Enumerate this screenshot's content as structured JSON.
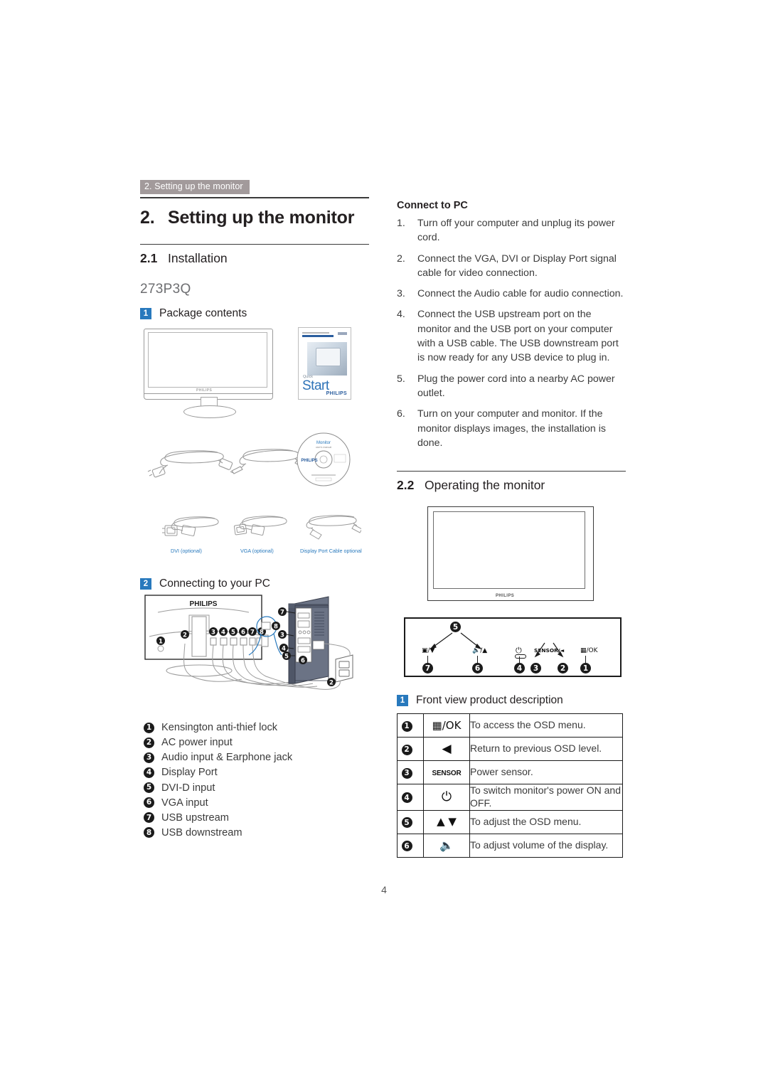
{
  "running_header": "2. Setting up the monitor",
  "chapter": {
    "number": "2.",
    "title": "Setting up the monitor"
  },
  "section_installation": {
    "number": "2.1",
    "title": "Installation"
  },
  "model": "273P3Q",
  "package_contents": {
    "badge": "1",
    "title": "Package contents",
    "monitor_brand": "PHILIPS",
    "guide": {
      "quick_label": "Quick",
      "start_label": "Start",
      "brand": "PHILIPS"
    },
    "cd": {
      "title": "Monitor",
      "subtitle": "user's manual",
      "brand": "PHILIPS"
    },
    "cable_labels": [
      "DVI (optional)",
      "VGA  (optional)",
      "Display Port Cable   optional"
    ]
  },
  "connecting": {
    "badge": "2",
    "title": "Connecting to your PC",
    "monitor_brand": "PHILIPS",
    "legend": [
      {
        "num": "1",
        "text": "Kensington anti-thief lock"
      },
      {
        "num": "2",
        "text": "AC power input"
      },
      {
        "num": "3",
        "text": "Audio input & Earphone jack"
      },
      {
        "num": "4",
        "text": "Display Port"
      },
      {
        "num": "5",
        "text": "DVI-D input"
      },
      {
        "num": "6",
        "text": "VGA input"
      },
      {
        "num": "7",
        "text": "USB upstream"
      },
      {
        "num": "8",
        "text": "USB downstream"
      }
    ]
  },
  "connect_to_pc": {
    "heading": "Connect to PC",
    "steps": [
      {
        "n": "1.",
        "t": "Turn off your computer and unplug its power cord."
      },
      {
        "n": "2.",
        "t": "Connect the VGA, DVI or Display Port signal cable for video connection."
      },
      {
        "n": "3.",
        "t": "Connect the Audio cable for audio connection."
      },
      {
        "n": "4.",
        "t": "Connect the USB upstream port on the monitor and the USB port on your computer with a USB cable. The USB downstream port is now ready for any USB device to plug in."
      },
      {
        "n": "5.",
        "t": "Plug the power cord into a nearby AC power outlet."
      },
      {
        "n": "6.",
        "t": "Turn on your computer and monitor. If the monitor displays images, the installation is done."
      }
    ]
  },
  "section_operating": {
    "number": "2.2",
    "title": "Operating the monitor"
  },
  "front_view": {
    "badge": "1",
    "title": "Front view product description",
    "panel_labels": [
      {
        "num": "7",
        "label": "✇/▼"
      },
      {
        "num": "6",
        "label": "◂)/▲"
      },
      {
        "num": "5",
        "label": ""
      },
      {
        "num": "4",
        "label": "power"
      },
      {
        "num": "3",
        "label": "SENSOR"
      },
      {
        "num": "2",
        "label": "/◄"
      },
      {
        "num": "1",
        "label": "▤/OK"
      }
    ],
    "panel_text_left": "/▼",
    "panel_text_vol": "/▲",
    "panel_text_sensor": "SENSOR/◄",
    "panel_text_ok": "/OK",
    "table": [
      {
        "num": "1",
        "icon": "menu-ok",
        "icon_text": "/OK",
        "desc": "To access the OSD menu."
      },
      {
        "num": "2",
        "icon": "left-triangle",
        "icon_text": "◀",
        "desc": "Return to previous OSD level."
      },
      {
        "num": "3",
        "icon": "sensor",
        "icon_text": "SENSOR",
        "desc": "Power sensor."
      },
      {
        "num": "4",
        "icon": "power",
        "icon_text": "⏻",
        "desc": "To switch monitor's power ON and OFF."
      },
      {
        "num": "5",
        "icon": "up-down-triangles",
        "icon_text": "▲ ▼",
        "desc": "To adjust the OSD menu."
      },
      {
        "num": "6",
        "icon": "speaker",
        "icon_text": "◂)",
        "desc": "To adjust volume of the display."
      }
    ]
  },
  "page_number": "4",
  "colors": {
    "header_bg": "#a29a9b",
    "badge_blue": "#2879bd",
    "cable_label_blue": "#2879bd",
    "ink": "#231f20"
  }
}
